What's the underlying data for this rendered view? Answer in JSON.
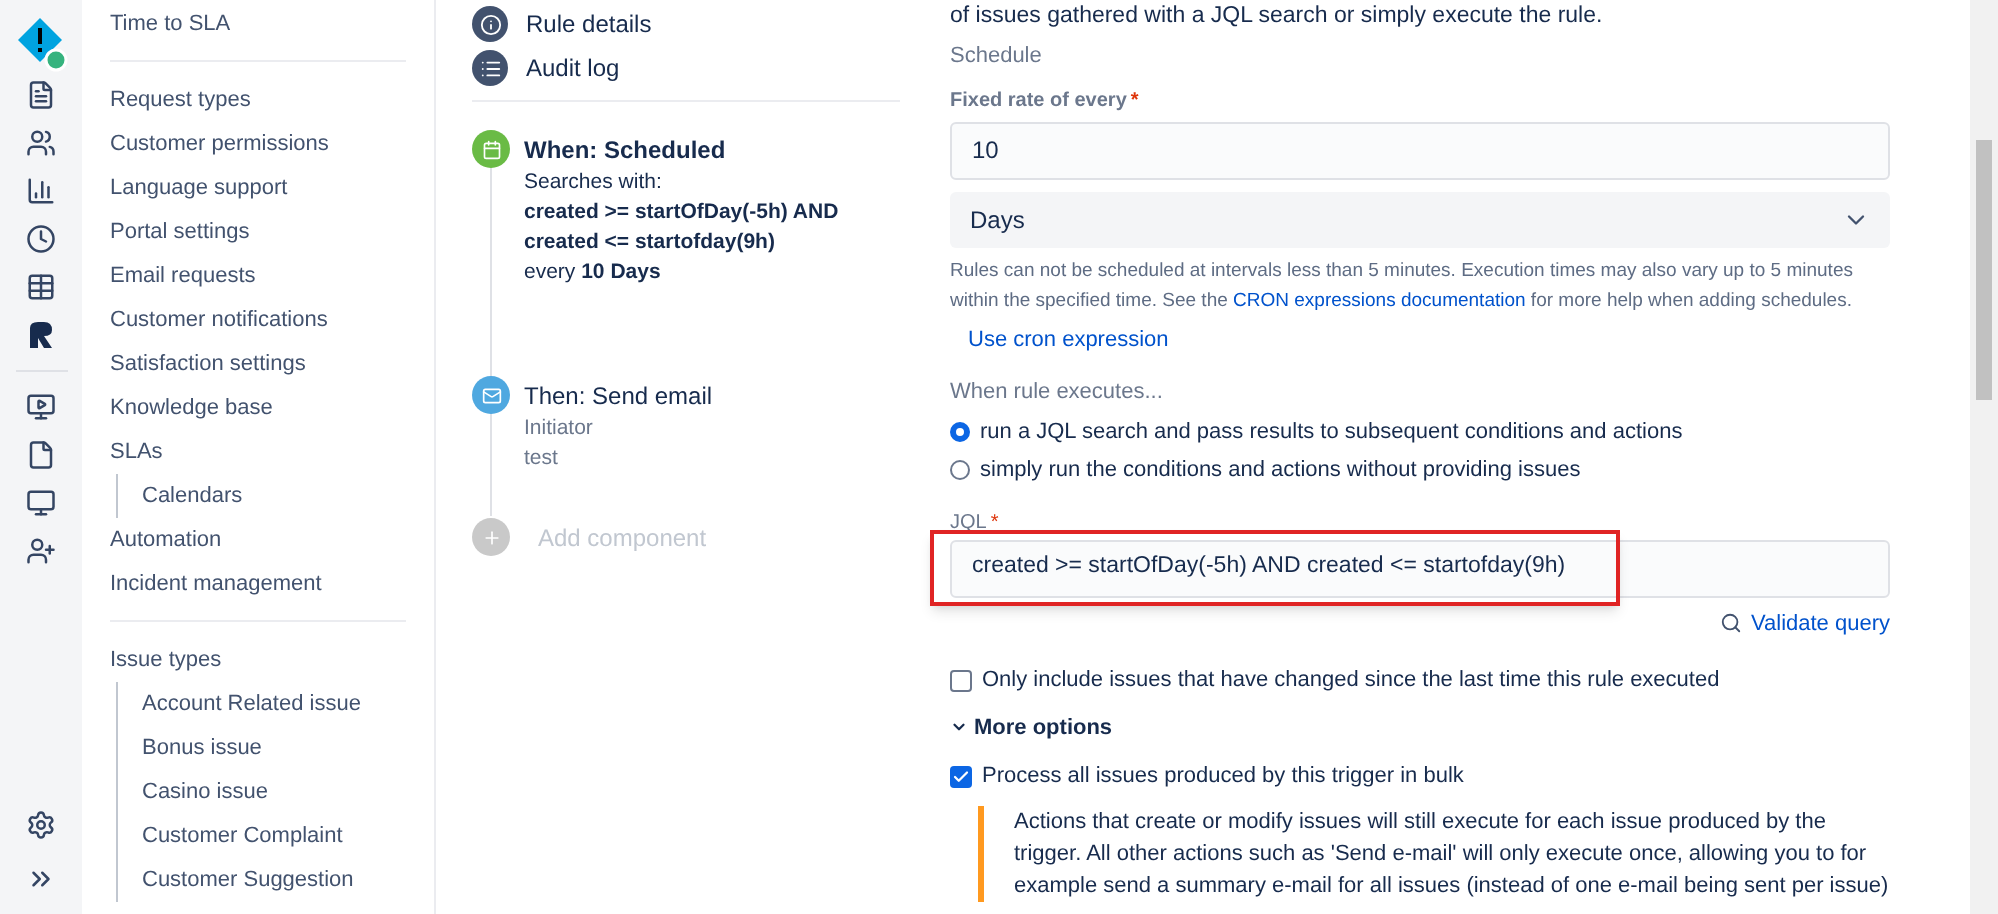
{
  "sidebar": {
    "sections": [
      {
        "items": [
          {
            "label": "Time to SLA"
          }
        ]
      },
      {
        "items": [
          {
            "label": "Request types"
          },
          {
            "label": "Customer permissions"
          },
          {
            "label": "Language support"
          },
          {
            "label": "Portal settings"
          },
          {
            "label": "Email requests"
          },
          {
            "label": "Customer notifications"
          },
          {
            "label": "Satisfaction settings"
          },
          {
            "label": "Knowledge base"
          },
          {
            "label": "SLAs",
            "children": [
              {
                "label": "Calendars"
              }
            ]
          },
          {
            "label": "Automation"
          },
          {
            "label": "Incident management"
          }
        ]
      },
      {
        "items": [
          {
            "label": "Issue types",
            "children": [
              {
                "label": "Account Related issue"
              },
              {
                "label": "Bonus issue"
              },
              {
                "label": "Casino issue"
              },
              {
                "label": "Customer Complaint"
              },
              {
                "label": "Customer Suggestion"
              }
            ]
          }
        ]
      }
    ]
  },
  "rule_nav": [
    {
      "kind": "details",
      "label": "Rule details"
    },
    {
      "kind": "audit",
      "label": "Audit log"
    }
  ],
  "steps": [
    {
      "kind": "trigger",
      "title": "When: Scheduled",
      "lines": [
        "Searches with:",
        "**created >= startOfDay(-5h) AND**",
        "**created <= startofday(9h)**",
        "every **10 Days**"
      ]
    },
    {
      "kind": "action",
      "title": "Then: Send email",
      "lines": [
        "Initiator",
        "test"
      ]
    },
    {
      "kind": "add",
      "title": "Add component"
    }
  ],
  "form": {
    "intro": "of issues gathered with a JQL search or simply execute the rule.",
    "schedule_heading": "Schedule",
    "rate": {
      "label": "Fixed rate of every",
      "required_mark": "*",
      "value": "10"
    },
    "unit": {
      "value": "Days"
    },
    "help": {
      "before": "Rules can not be scheduled at intervals less than 5 minutes. Execution times may also vary up to 5 minutes within the specified time. See the ",
      "link": "CRON expressions documentation",
      "after": " for more help when adding schedules."
    },
    "cron_link": "Use cron expression",
    "executes_label": "When rule executes...",
    "options": [
      {
        "label": "run a JQL search and pass results to subsequent conditions and actions",
        "selected": true
      },
      {
        "label": "simply run the conditions and actions without providing issues",
        "selected": false
      }
    ],
    "jql": {
      "label": "JQL",
      "required_mark": "*",
      "value": "created >= startOfDay(-5h) AND created <= startofday(9h)",
      "highlighted": true
    },
    "validate": "Validate query",
    "only_changed": {
      "label": "Only include issues that have changed since the last time this rule executed",
      "checked": false
    },
    "more_options": {
      "label": "More options",
      "expanded": true
    },
    "bulk": {
      "label": "Process all issues produced by this trigger in bulk",
      "checked": true
    },
    "note": "Actions that create or modify issues will still execute for each issue produced by the trigger. All other actions such as 'Send e-mail' will only execute once, allowing you to for example send a summary e-mail for all issues (instead of one e-mail being sent per issue)"
  }
}
